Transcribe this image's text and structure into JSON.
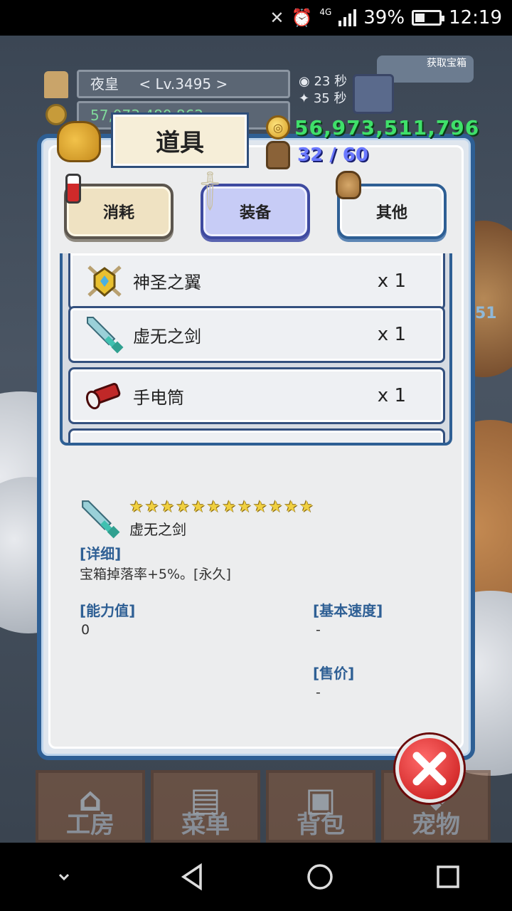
{
  "status_bar": {
    "network": "4G",
    "battery": "39%",
    "battery_level": 0.39,
    "time": "12:19"
  },
  "hud": {
    "player_name": "夜皇",
    "level": "< Lv.3495 >",
    "gold_partial": "57,073,480,862",
    "timer_1": "23 秒",
    "timer_2": "35 秒",
    "gift_label": "获取宝箱",
    "side_number": "51"
  },
  "dialog": {
    "title": "道具",
    "gold": "56,973,511,796",
    "capacity": "32 / 60",
    "tabs": [
      {
        "label": "消耗",
        "selected": false
      },
      {
        "label": "装备",
        "selected": true
      },
      {
        "label": "其他",
        "selected": false
      }
    ],
    "items": [
      {
        "name": "神圣之翼",
        "count": "x 1",
        "icon": "holy-wings-icon"
      },
      {
        "name": "虚无之剑",
        "count": "x 1",
        "icon": "void-sword-icon"
      },
      {
        "name": "手电筒",
        "count": "x 1",
        "icon": "flashlight-icon"
      }
    ],
    "detail": {
      "star_count": 12,
      "name": "虚无之剑",
      "detail_heading": "[详细]",
      "detail_text": "宝箱掉落率+5%。[永久]",
      "power_heading": "[能力值]",
      "power_value": "0",
      "speed_heading": "[基本速度]",
      "speed_value": "-",
      "price_heading": "[售价]",
      "price_value": "-"
    }
  },
  "bottom_tabs": [
    {
      "label": "工房",
      "icon": "workshop-icon"
    },
    {
      "label": "菜单",
      "icon": "book-icon"
    },
    {
      "label": "背包",
      "icon": "backpack-icon"
    },
    {
      "label": "宠物",
      "icon": "pet-icon"
    }
  ],
  "colors": {
    "dialog_border": "#2e5f94",
    "gold_text": "#3fe06a",
    "capacity_text": "#6a78ff",
    "selected_tab": "#c7ccf6",
    "close_button": "#c41414"
  }
}
